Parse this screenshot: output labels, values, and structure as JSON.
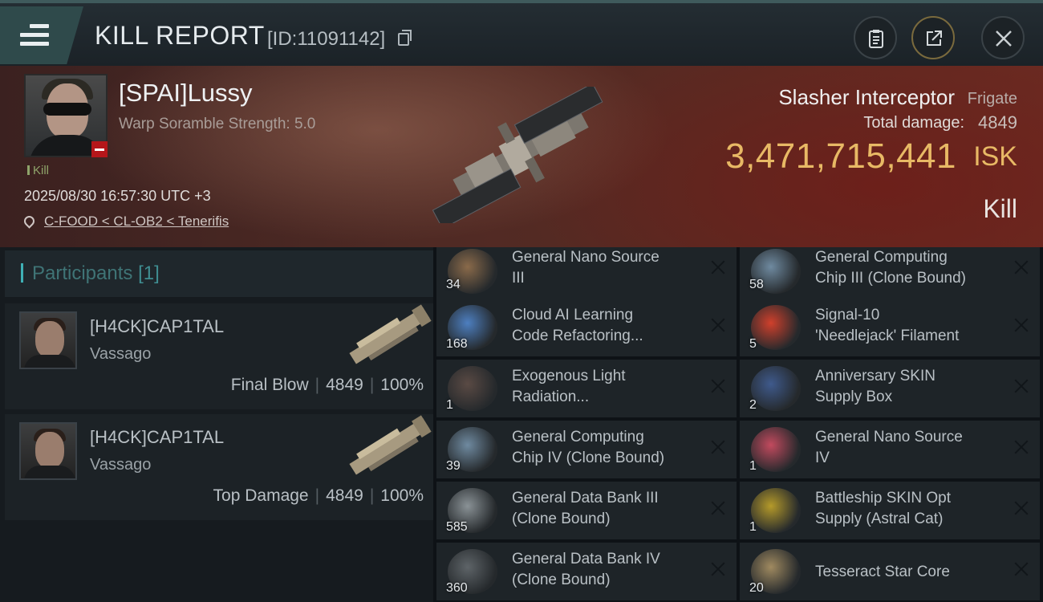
{
  "header": {
    "title": "KILL REPORT",
    "report_id": "[ID:11091142]"
  },
  "victim": {
    "name": "[SPAI]Lussy",
    "warp_scramble": "Warp Soramble Strength: 5.0",
    "kill_tag": "Kill",
    "timestamp": "2025/08/30 16:57:30 UTC +3",
    "location": "C-FOOD < CL-OB2 < Tenerifis",
    "ship_name": "Slasher Interceptor",
    "ship_class": "Frigate",
    "total_damage_label": "Total damage:",
    "total_damage": "4849",
    "isk_value": "3,471,715,441",
    "isk_unit": "ISK",
    "result": "Kill"
  },
  "participants": {
    "label": "Participants",
    "count": "[1]",
    "rows": [
      {
        "name": "[H4CK]CAP1TAL",
        "ship": "Vassago",
        "role": "Final Blow",
        "damage": "4849",
        "percent": "100%"
      },
      {
        "name": "[H4CK]CAP1TAL",
        "ship": "Vassago",
        "role": "Top Damage",
        "damage": "4849",
        "percent": "100%"
      }
    ]
  },
  "items": [
    {
      "qty": "34",
      "line1": "General Nano Source",
      "line2": "III",
      "icon": "nano-source-icon",
      "color": "#8a6a4a"
    },
    {
      "qty": "58",
      "line1": "General Computing",
      "line2": "Chip III (Clone Bound)",
      "icon": "computing-chip-icon",
      "color": "#6f8aa0"
    },
    {
      "qty": "168",
      "line1": "Cloud AI Learning",
      "line2": "Code Refactoring...",
      "icon": "ai-learning-icon",
      "color": "#4d7fc0"
    },
    {
      "qty": "5",
      "line1": "Signal-10",
      "line2": "'Needlejack' Filament",
      "icon": "filament-icon",
      "color": "#d0402c"
    },
    {
      "qty": "1",
      "line1": "Exogenous Light",
      "line2": "Radiation...",
      "icon": "radiation-icon",
      "color": "#5a4a44"
    },
    {
      "qty": "2",
      "line1": "Anniversary SKIN",
      "line2": "Supply Box",
      "icon": "supply-box-icon",
      "color": "#3f5a8c"
    },
    {
      "qty": "39",
      "line1": "General Computing",
      "line2": "Chip IV (Clone Bound)",
      "icon": "computing-chip-icon",
      "color": "#6f8aa0"
    },
    {
      "qty": "1",
      "line1": "General Nano Source",
      "line2": "IV",
      "icon": "nano-source-icon",
      "color": "#c24a5e"
    },
    {
      "qty": "585",
      "line1": "General Data Bank III",
      "line2": "(Clone Bound)",
      "icon": "data-bank-icon",
      "color": "#8a9296"
    },
    {
      "qty": "1",
      "line1": "Battleship SKIN Opt",
      "line2": "Supply (Astral Cat)",
      "icon": "skin-supply-icon",
      "color": "#b59a2a"
    },
    {
      "qty": "360",
      "line1": "General Data Bank IV",
      "line2": "(Clone Bound)",
      "icon": "data-bank-icon",
      "color": "#5e6468"
    },
    {
      "qty": "20",
      "line1": "Tesseract Star Core",
      "line2": "",
      "icon": "star-core-icon",
      "color": "#a08a60"
    }
  ]
}
